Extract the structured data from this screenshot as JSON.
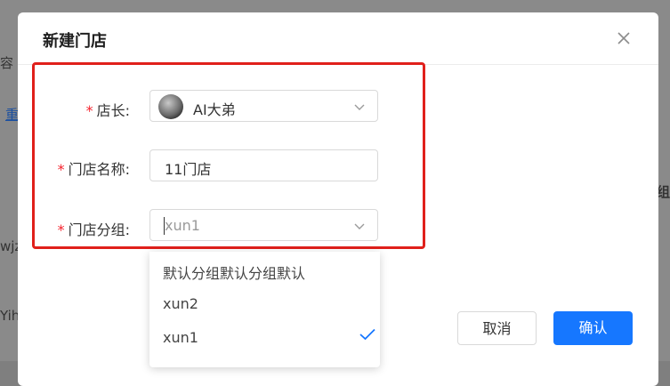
{
  "background": {
    "fragments": [
      "容",
      "重",
      "组",
      "wjz",
      "Yih"
    ]
  },
  "modal": {
    "title": "新建门店",
    "close_icon": "close-icon"
  },
  "form": {
    "required_mark": "*",
    "manager": {
      "label": "店长:",
      "value": "AI大弟"
    },
    "store_name": {
      "label": "门店名称:",
      "value": "11门店"
    },
    "store_group": {
      "label": "门店分组:",
      "placeholder": "xun1"
    }
  },
  "dropdown": {
    "options": [
      "默认分组默认分组默认",
      "xun2",
      "xun1"
    ],
    "selected": "xun1"
  },
  "buttons": {
    "cancel": "取消",
    "confirm": "确认"
  },
  "colors": {
    "primary": "#1677ff",
    "required": "#f5222d",
    "highlight_border": "#e0201b"
  }
}
